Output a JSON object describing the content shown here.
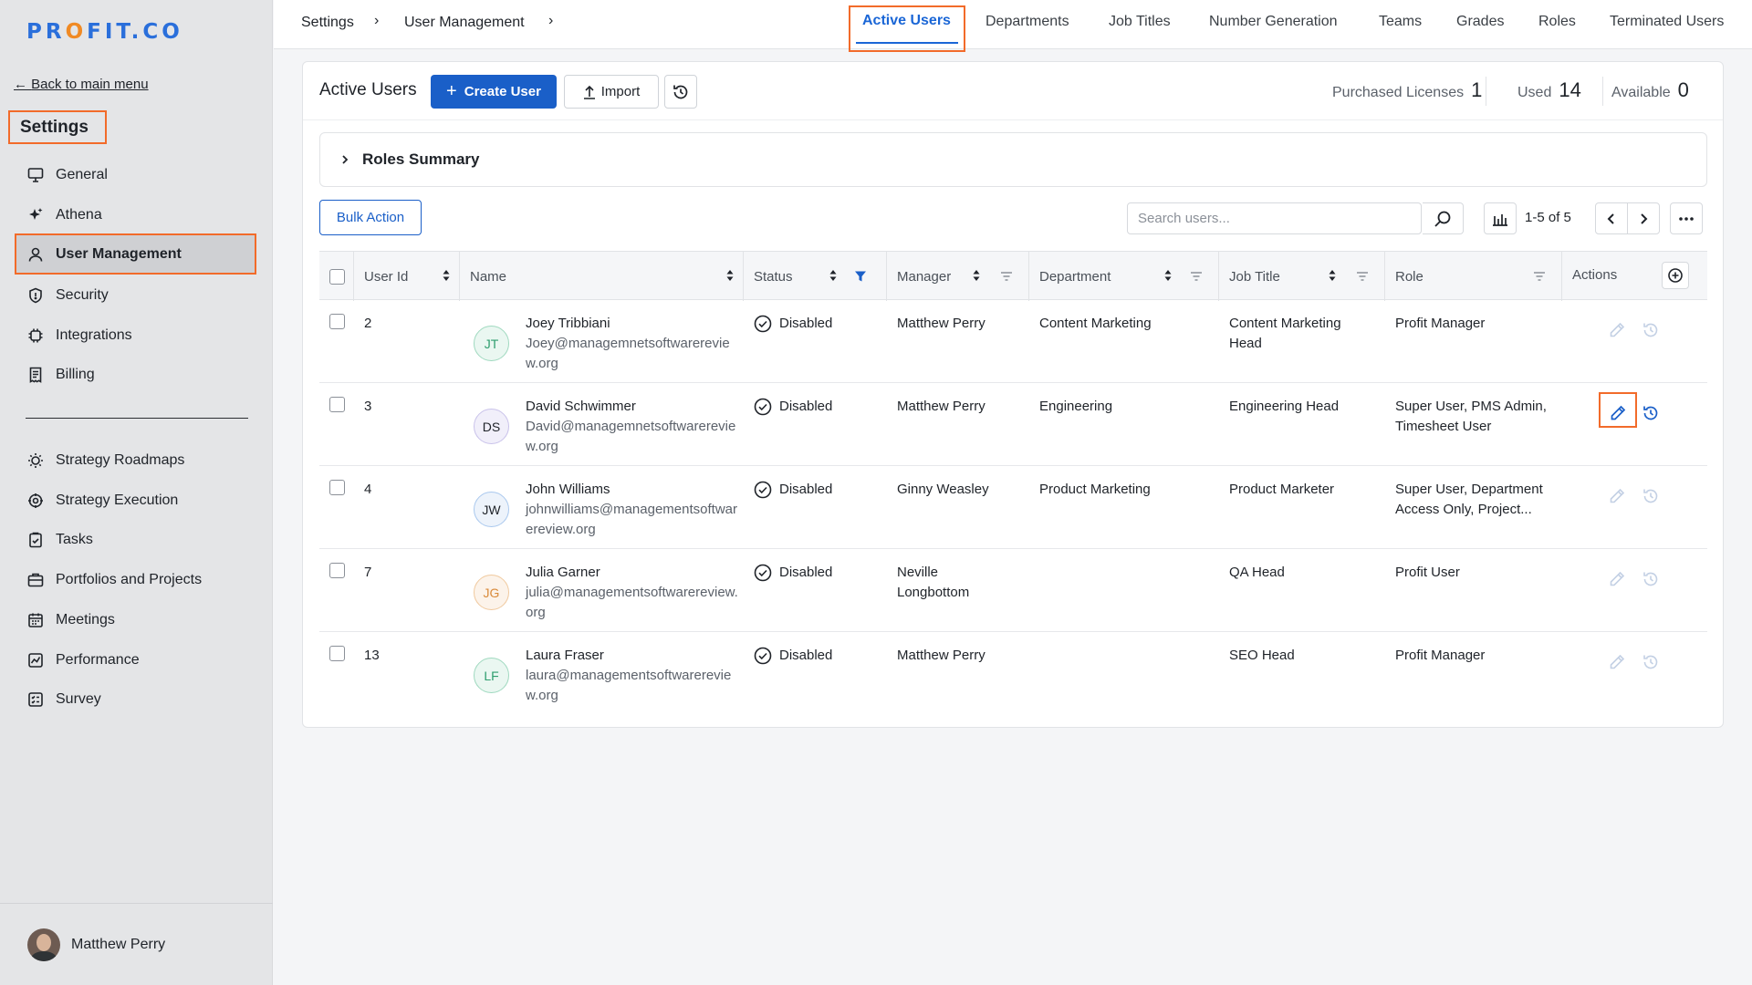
{
  "sidebar": {
    "logo": {
      "part1": "PR",
      "dot": "O",
      "part2": "FIT.CO"
    },
    "back_link": "Back to main menu",
    "settings_title": "Settings",
    "items": [
      {
        "label": "General",
        "icon": "monitor-icon"
      },
      {
        "label": "Athena",
        "icon": "sparkle-icon"
      },
      {
        "label": "User Management",
        "icon": "user-icon",
        "active": true
      },
      {
        "label": "Security",
        "icon": "shield-icon"
      },
      {
        "label": "Integrations",
        "icon": "chip-icon"
      },
      {
        "label": "Billing",
        "icon": "receipt-icon"
      }
    ],
    "items2": [
      {
        "label": "Strategy Roadmaps",
        "icon": "bulb-icon"
      },
      {
        "label": "Strategy Execution",
        "icon": "target-icon"
      },
      {
        "label": "Tasks",
        "icon": "clipboard-check-icon"
      },
      {
        "label": "Portfolios and Projects",
        "icon": "briefcase-icon"
      },
      {
        "label": "Meetings",
        "icon": "calendar-icon"
      },
      {
        "label": "Performance",
        "icon": "chart-icon"
      },
      {
        "label": "Survey",
        "icon": "checklist-icon"
      }
    ],
    "user_name": "Matthew Perry"
  },
  "topnav": {
    "breadcrumbs": [
      "Settings",
      "User Management"
    ],
    "separator": "›",
    "active_tab": "Active Users",
    "tabs": [
      "Departments",
      "Job Titles",
      "Number Generation",
      "Teams",
      "Grades",
      "Roles",
      "Terminated Users"
    ]
  },
  "header": {
    "title": "Active Users",
    "create_label": "Create User",
    "create_plus": "+",
    "import_label": "Import",
    "licenses": {
      "purchased_label": "Purchased Licenses",
      "purchased_value": "1",
      "used_label": "Used",
      "used_value": "14",
      "available_label": "Available",
      "available_value": "0"
    }
  },
  "roles_summary": {
    "label": "Roles Summary"
  },
  "toolbar": {
    "bulk_label": "Bulk Action",
    "search_placeholder": "Search users...",
    "range": "1-5 of 5"
  },
  "table": {
    "columns": [
      "User Id",
      "Name",
      "Status",
      "Manager",
      "Department",
      "Job Title",
      "Role",
      "Actions"
    ],
    "rows": [
      {
        "id": "2",
        "initials": "JT",
        "name": "Joey Tribbiani",
        "email": "Joey@managemnetsoftwarereview.org",
        "status": "Disabled",
        "manager": "Matthew Perry",
        "department": "Content Marketing",
        "job_title": "Content Marketing Head",
        "role": "Profit Manager",
        "avatar_color": "#2f9e6e",
        "avatar_bg": "#eaf7f1"
      },
      {
        "id": "3",
        "initials": "DS",
        "name": "David Schwimmer",
        "email": "David@managemnetsoftwarereview.org",
        "status": "Disabled",
        "manager": "Matthew Perry",
        "department": "Engineering",
        "job_title": "Engineering Head",
        "role": "Super User, PMS Admin, Timesheet User",
        "avatar_color": "#7b6bc9",
        "avatar_bg": "#f1effa"
      },
      {
        "id": "4",
        "initials": "JW",
        "name": "John Williams",
        "email": "johnwilliams@managementsoftwarereview.org",
        "status": "Disabled",
        "manager": "Ginny Weasley",
        "department": "Product Marketing",
        "job_title": "Product Marketer",
        "role": "Super User, Department Access Only, Project...",
        "avatar_color": "#3a7fd0",
        "avatar_bg": "#edf3fb"
      },
      {
        "id": "7",
        "initials": "JG",
        "name": "Julia Garner",
        "email": "julia@managementsoftwarereview.org",
        "status": "Disabled",
        "manager": "Neville Longbottom",
        "department": "",
        "job_title": "QA Head",
        "role": "Profit User",
        "avatar_color": "#d98a3a",
        "avatar_bg": "#fcf3ea"
      },
      {
        "id": "13",
        "initials": "LF",
        "name": "Laura Fraser",
        "email": "laura@managementsoftwarereview.org",
        "status": "Disabled",
        "manager": "Matthew Perry",
        "department": "",
        "job_title": "SEO Head",
        "role": "Profit Manager",
        "avatar_color": "#2f9e6e",
        "avatar_bg": "#eaf7f1"
      }
    ]
  },
  "colors": {
    "accent": "#1a5fc8",
    "highlight": "#f26b2a"
  }
}
